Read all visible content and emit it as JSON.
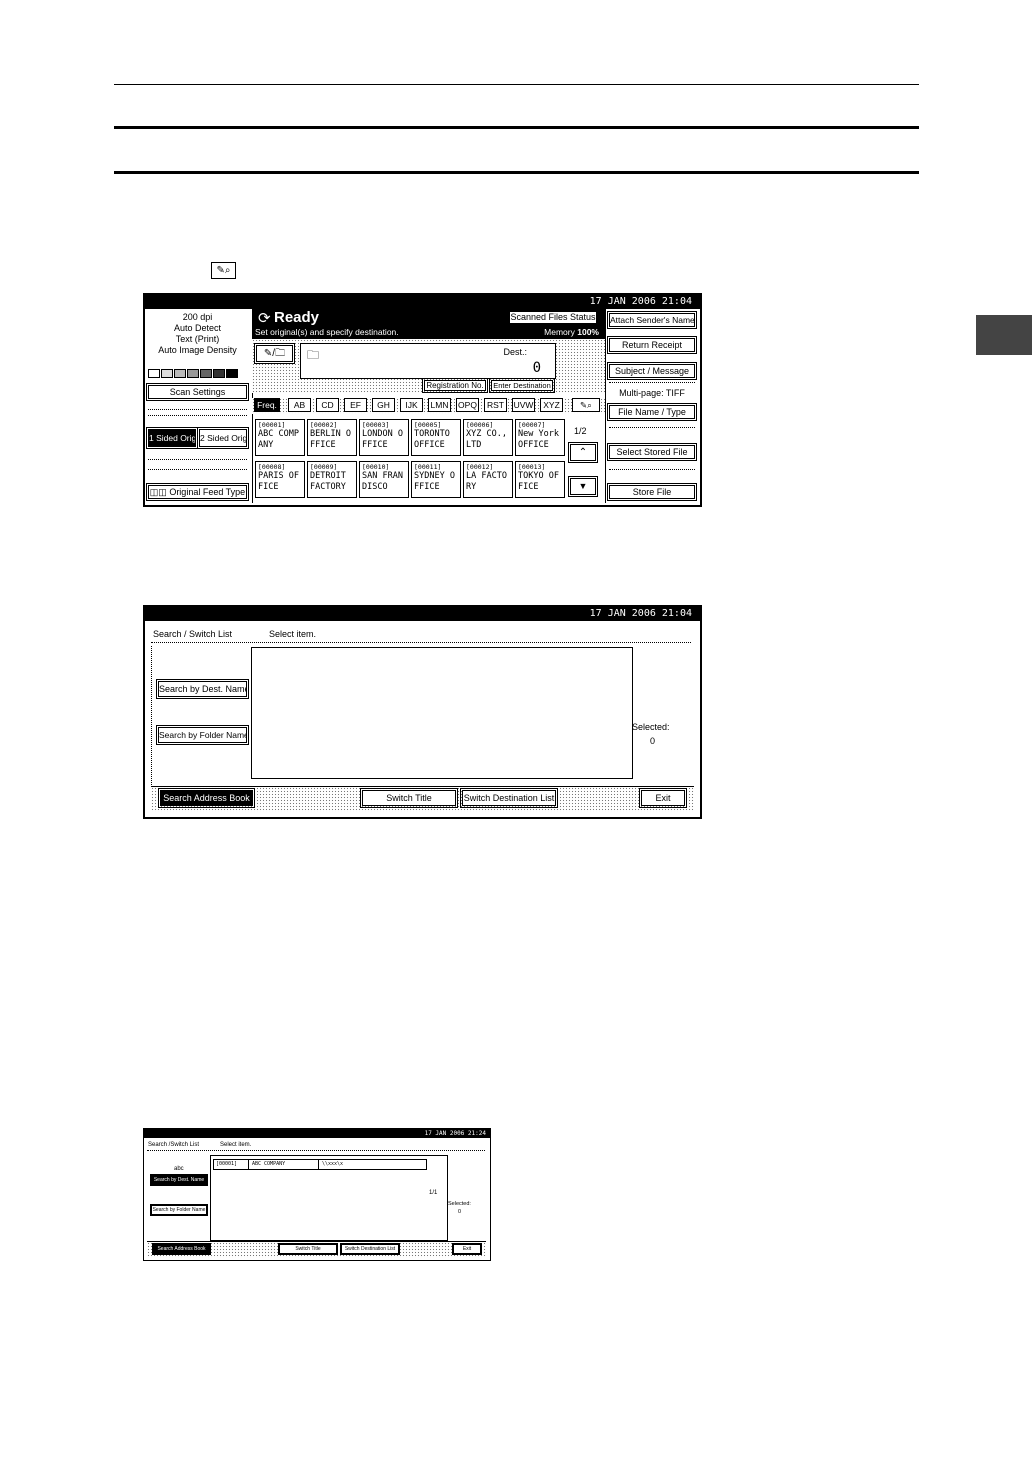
{
  "page": {
    "inline_icon": "search-dest-icon",
    "tab_color": "#444444"
  },
  "screen1": {
    "datetime": "17  JAN   2006 21:04",
    "left": {
      "settings": [
        "200 dpi",
        "Auto Detect",
        "Text (Print)",
        "Auto Image Density"
      ],
      "density_levels": 7,
      "density_selected": 4,
      "scan_settings": "Scan Settings",
      "one_sided": "1 Sided Orig.",
      "two_sided": "2 Sided Orig.",
      "feed_type": "Original Feed Type"
    },
    "status_title": "Ready",
    "status_message": "Set original(s) and specify destination.",
    "scanned_files_status": "Scanned Files Status",
    "memory_label": "Memory",
    "memory_value": "100%",
    "dest_label": "Dest.:",
    "dest_count": "0",
    "registration_no": "Registration No.",
    "enter_destination": "Enter Destination",
    "tabs": [
      "Freq.",
      "AB",
      "CD",
      "EF",
      "GH",
      "IJK",
      "LMN",
      "OPQ",
      "RST",
      "UVW",
      "XYZ"
    ],
    "page_indicator": "1/2",
    "destinations": [
      {
        "id": "[00001]",
        "name": "ABC COMP ANY"
      },
      {
        "id": "[00002]",
        "name": "BERLIN O FFICE"
      },
      {
        "id": "[00003]",
        "name": "LONDON O FFICE"
      },
      {
        "id": "[00005]",
        "name": "TORONTO OFFICE"
      },
      {
        "id": "[00006]",
        "name": "XYZ CO., LTD"
      },
      {
        "id": "[00007]",
        "name": "New York OFFICE"
      },
      {
        "id": "[00008]",
        "name": "PARIS OF FICE"
      },
      {
        "id": "[00009]",
        "name": "DETROIT FACTORY"
      },
      {
        "id": "[00010]",
        "name": "SAN FRAN DISCO"
      },
      {
        "id": "[00011]",
        "name": "SYDNEY O FFICE"
      },
      {
        "id": "[00012]",
        "name": "LA FACTO RY"
      },
      {
        "id": "[00013]",
        "name": "TOKYO OF FICE"
      }
    ],
    "right": {
      "attach_sender": "Attach Sender's Name",
      "return_receipt": "Return Receipt",
      "subject_message": "Subject / Message",
      "multipage": "Multi-page: TIFF",
      "file_name_type": "File Name / Type",
      "select_stored_file": "Select Stored File",
      "store_file": "Store File"
    }
  },
  "screen2": {
    "datetime": "17  JAN   2006 21:04",
    "header_title": "Search / Switch List",
    "header_instruction": "Select item.",
    "search_dest_name": "Search by Dest. Name",
    "search_folder_name": "Search by Folder Name",
    "selected_label": "Selected:",
    "selected_count": "0",
    "search_address_book": "Search Address Book",
    "switch_title": "Switch Title",
    "switch_dest_list": "Switch Destination List",
    "exit": "Exit"
  },
  "screen3": {
    "datetime": "17  JAN   2006 21:24",
    "header_title": "Search /Switch List",
    "header_instruction": "Select item.",
    "search_text": "abc",
    "search_dest_name": "Search by Dest. Name",
    "search_folder_name": "Search by Folder Name",
    "result": {
      "id": "[00001]",
      "name": "ABC COMPANY",
      "path": "\\\\xxx\\x"
    },
    "page_indicator": "1/1",
    "selected_label": "Selected:",
    "selected_count": "0",
    "search_address_book": "Search Address Book",
    "switch_title": "Switch Title",
    "switch_dest_list": "Switch Destination List",
    "exit": "Exit"
  }
}
